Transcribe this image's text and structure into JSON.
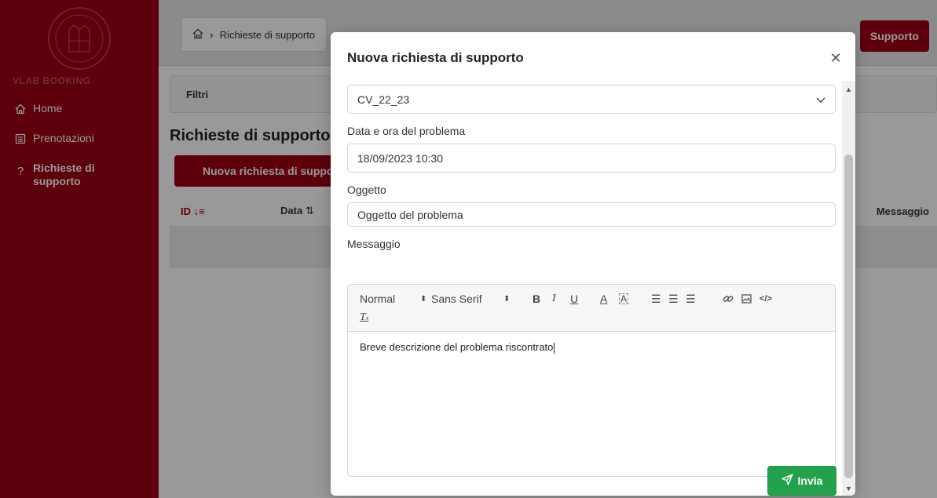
{
  "sidebar": {
    "app_name": "VLAB BOOKING",
    "items": [
      {
        "label": "Home",
        "icon": "home-icon"
      },
      {
        "label": "Prenotazioni",
        "icon": "list-icon"
      },
      {
        "label": "Richieste di supporto",
        "icon": "question-icon"
      }
    ]
  },
  "header": {
    "breadcrumb": "Richieste di supporto",
    "support_label": "Supporto"
  },
  "main": {
    "filters_label": "Filtri",
    "title": "Richieste di supporto",
    "new_request_label": "Nuova richiesta di supporto",
    "columns": {
      "id": "ID",
      "data": "Data",
      "messaggio": "Messaggio"
    }
  },
  "modal": {
    "title": "Nuova richiesta di supporto",
    "select_value": "CV_22_23",
    "date_label": "Data e ora del problema",
    "date_value": "18/09/2023 10:30",
    "subject_label": "Oggetto",
    "subject_value": "Oggetto del problema",
    "message_label": "Messaggio",
    "toolbar": {
      "size": "Normal",
      "font": "Sans Serif"
    },
    "message_value": "Breve descrizione del problema riscontrato",
    "send_label": "Invia"
  },
  "colors": {
    "brand": "#9b0014",
    "send": "#22a24a"
  }
}
